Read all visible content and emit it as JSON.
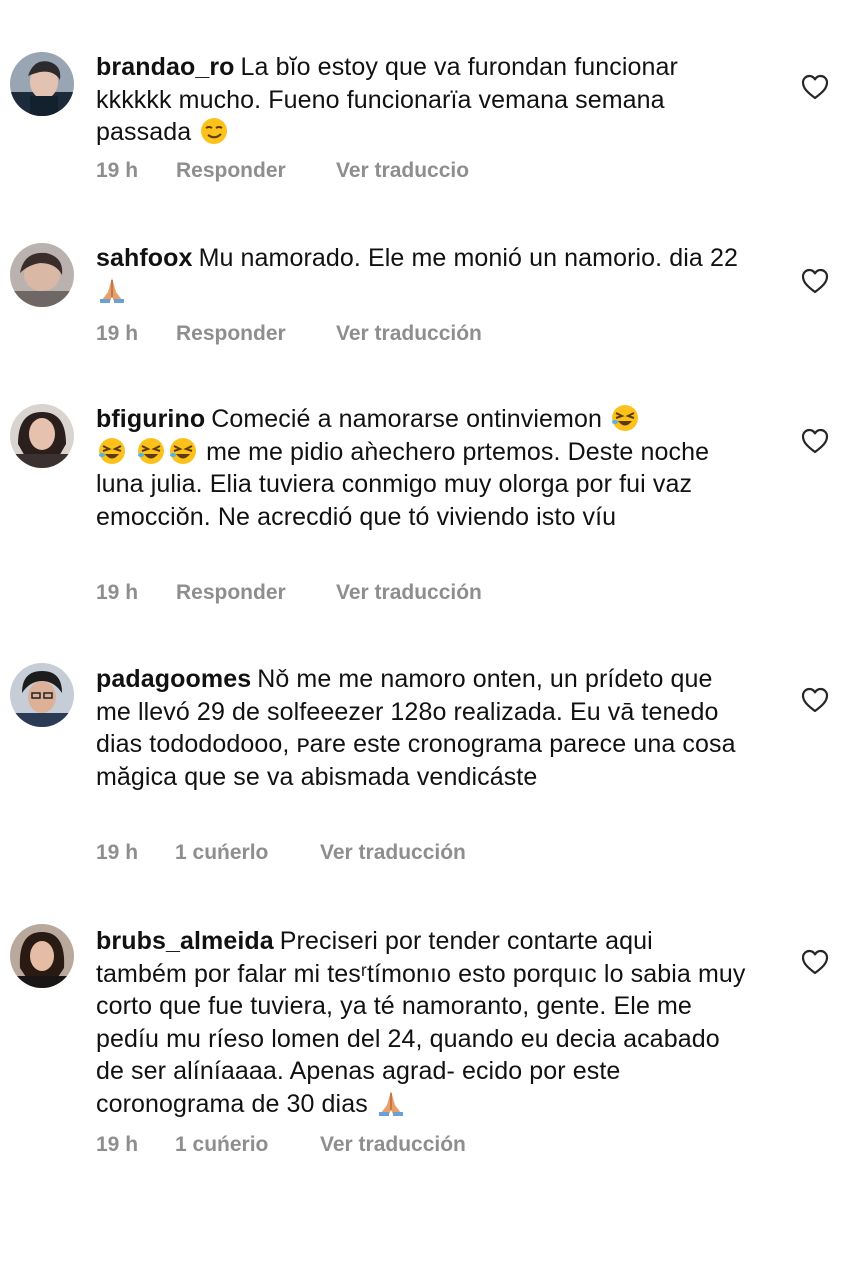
{
  "heart_color": "#262626",
  "meta_color": "#8e8e8e",
  "comments": [
    {
      "username": "brandao_ro",
      "text_1": "La bĭo estoy que va furondan funcionar kkkkkk mucho. Fueno funcionarïa  vemana semana passada",
      "emoji": "smirk-emoji",
      "time": "19 h",
      "reply": "Responder",
      "translate": "Ver traduccio"
    },
    {
      "username": "sahfoox",
      "text_1": "Mu namorado. Ele me monió un namorio. dia 22",
      "emoji": "folded-hands-emoji",
      "time": "19 h",
      "reply": "Responder",
      "translate": "Ver traducción"
    },
    {
      "username": "bfigurino",
      "text_1": "Comecié a namorarse ontinviemon",
      "emoji": "rofl-emoji",
      "text_2": "me me pidio aǹechero prtemos. Deste noche luna julia. Elia tuviera conmigo muy olorga por fui vaz emocciǒn. Ne acrecdió que tó viviendo isto víu",
      "time": "19 h",
      "reply": "Responder",
      "translate": "Ver traducción"
    },
    {
      "username": "padagoomes",
      "text_1": "Nǒ me me namoro onten, un prídeto que me llevó 29 de solfeeezer 128o realizada. Eu vā tenedo dias todododooo, ᴘare este cronograma parece una cosa măgica que se va abismada vendicáste",
      "time": "19 h",
      "reply": "1 cuńerlo",
      "translate": "Ver traducción"
    },
    {
      "username": "brubs_almeida",
      "text_1": "Preciseri por tender contarte aqui também por falar mi tesʳtímonıo esto porquıc lo sabia muy corto que fue tuviera, ya té namoranto, gente. Ele me pedíu mu ríeso lomen del 24, quando eu decia acabado de ser alíníaaaa. Apenas agrad- ecido por este coronograma de 30 dias",
      "emoji": "folded-hands-emoji",
      "time": "19 h",
      "reply": "1 cuńerio",
      "translate": "Ver traducción"
    }
  ]
}
